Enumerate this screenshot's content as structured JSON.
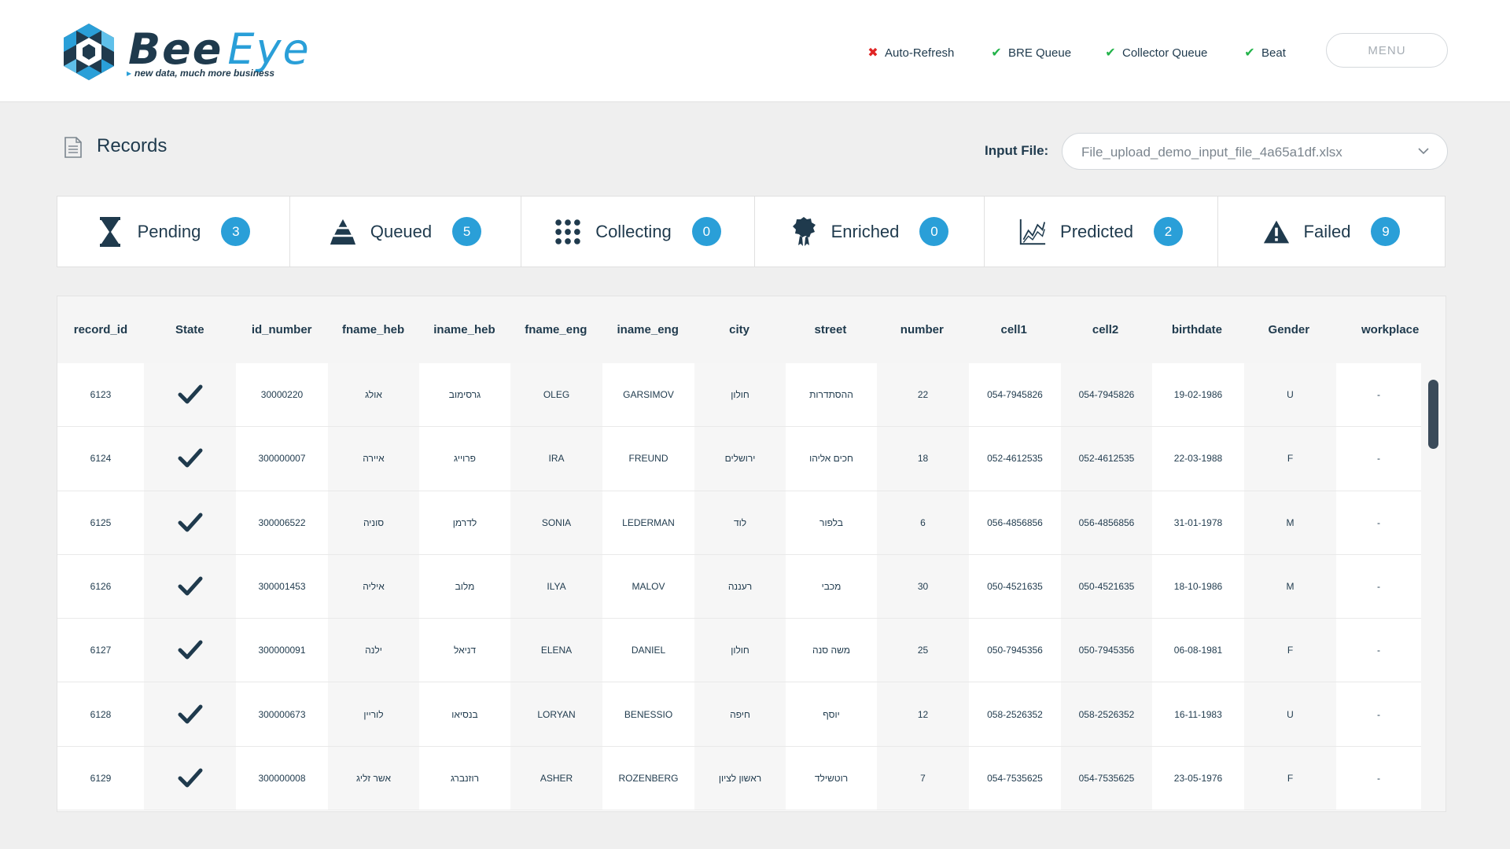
{
  "app": {
    "logo_bee": "Bee",
    "logo_eye": "Eye",
    "logo_tagline": "new data, much more business"
  },
  "header": {
    "statuses": [
      {
        "label": "Auto-Refresh",
        "state": "error",
        "icon": "x-icon"
      },
      {
        "label": "BRE Queue",
        "state": "ok",
        "icon": "check-icon"
      },
      {
        "label": "Collector Queue",
        "state": "ok",
        "icon": "check-icon"
      },
      {
        "label": "Beat",
        "state": "ok",
        "icon": "check-icon"
      }
    ],
    "menu_label": "MENU"
  },
  "page": {
    "title": "Records",
    "input_file_label": "Input File:",
    "input_file_value": "File_upload_demo_input_file_4a65a1df.xlsx"
  },
  "cards": [
    {
      "label": "Pending",
      "count": "3",
      "icon": "hourglass-icon"
    },
    {
      "label": "Queued",
      "count": "5",
      "icon": "stack-icon"
    },
    {
      "label": "Collecting",
      "count": "0",
      "icon": "dots-grid-icon"
    },
    {
      "label": "Enriched",
      "count": "0",
      "icon": "award-badge-icon"
    },
    {
      "label": "Predicted",
      "count": "2",
      "icon": "line-chart-icon"
    },
    {
      "label": "Failed",
      "count": "9",
      "icon": "warning-icon"
    }
  ],
  "table": {
    "columns": [
      "record_id",
      "State",
      "id_number",
      "fname_heb",
      "iname_heb",
      "fname_eng",
      "iname_eng",
      "city",
      "street",
      "number",
      "cell1",
      "cell2",
      "birthdate",
      "Gender",
      "workplace"
    ],
    "rows": [
      [
        "6123",
        "check",
        "30000220",
        "אולג",
        "גרסימוב",
        "OLEG",
        "GARSIMOV",
        "חולון",
        "ההסתדרות",
        "22",
        "054-7945826",
        "054-7945826",
        "19-02-1986",
        "U",
        "-"
      ],
      [
        "6124",
        "check",
        "300000007",
        "איירה",
        "פרוייג",
        "IRA",
        "FREUND",
        "ירושלים",
        "חכים אליהו",
        "18",
        "052-4612535",
        "052-4612535",
        "22-03-1988",
        "F",
        "-"
      ],
      [
        "6125",
        "check",
        "300006522",
        "סוניה",
        "לדרמן",
        "SONIA",
        "LEDERMAN",
        "לוד",
        "בלפור",
        "6",
        "056-4856856",
        "056-4856856",
        "31-01-1978",
        "M",
        "-"
      ],
      [
        "6126",
        "check",
        "300001453",
        "איליה",
        "מלוב",
        "ILYA",
        "MALOV",
        "רעננה",
        "מכבי",
        "30",
        "050-4521635",
        "050-4521635",
        "18-10-1986",
        "M",
        "-"
      ],
      [
        "6127",
        "check",
        "300000091",
        "ילנה",
        "דניאל",
        "ELENA",
        "DANIEL",
        "חולון",
        "משה סנה",
        "25",
        "050-7945356",
        "050-7945356",
        "06-08-1981",
        "F",
        "-"
      ],
      [
        "6128",
        "check",
        "300000673",
        "לוריין",
        "בנסיאו",
        "LORYAN",
        "BENESSIO",
        "חיפה",
        "יוסף",
        "12",
        "058-2526352",
        "058-2526352",
        "16-11-1983",
        "U",
        "-"
      ],
      [
        "6129",
        "check",
        "300000008",
        "אשר זליג",
        "רוזנברג",
        "ASHER",
        "ROZENBERG",
        "ראשון לציון",
        "רוטשילד",
        "7",
        "054-7535625",
        "054-7535625",
        "23-05-1976",
        "F",
        "-"
      ]
    ]
  },
  "colors": {
    "accent": "#2a9fd8",
    "navy": "#1f3a4d",
    "ok": "#23b34a",
    "error": "#e02424"
  }
}
